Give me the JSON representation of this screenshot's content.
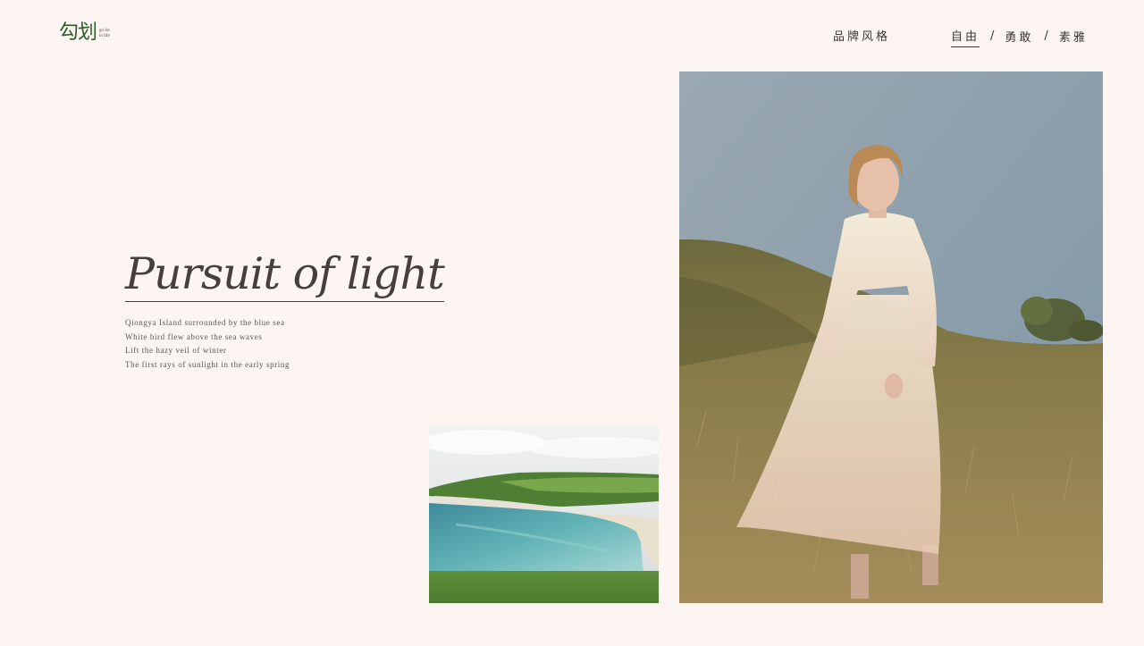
{
  "logo": {
    "mark": "勾划",
    "tagline": [
      "go for",
      "in life"
    ]
  },
  "header": {
    "brand_style": "品牌风格",
    "nav": [
      {
        "label": "自由",
        "active": true
      },
      {
        "label": "勇敢",
        "active": false
      },
      {
        "label": "素雅",
        "active": false
      }
    ],
    "separator": "/"
  },
  "hero": {
    "title": "Pursuit of light",
    "lines": [
      "Qiongya Island surrounded by the blue sea",
      "White bird flew above the sea waves",
      "Lift the hazy veil of winter",
      "The first rays of sunlight in the early spring"
    ]
  },
  "colors": {
    "background": "#fdf5f1",
    "text": "#45403d",
    "logo_green": "#2f5b2c"
  }
}
